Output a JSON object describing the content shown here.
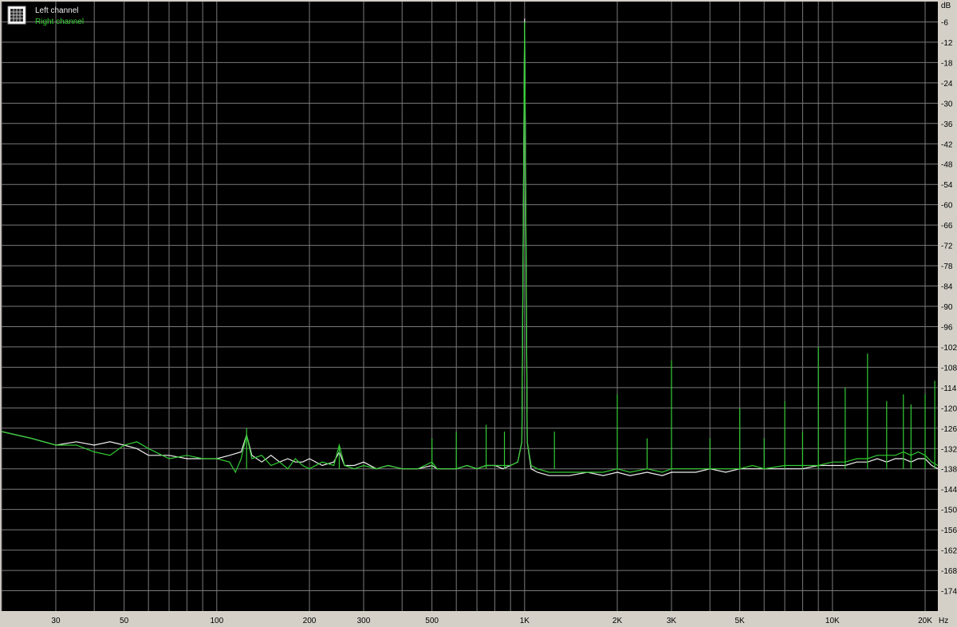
{
  "colors": {
    "plot_background": "#000000",
    "frame_background": "#d4d0c8",
    "grid": "#7a7a7a",
    "left_channel": "#f0f0f0",
    "right_channel": "#33cc33",
    "axis_text": "#000000"
  },
  "legend": {
    "icon": "grid-chart-icon",
    "items": [
      {
        "label": "Left channel",
        "color": "#f0f0f0"
      },
      {
        "label": "Right channel",
        "color": "#33cc33"
      }
    ]
  },
  "chart_data": {
    "type": "line",
    "x_scale": "log",
    "xlim": [
      20,
      22000
    ],
    "ylim": [
      -180,
      0
    ],
    "x_unit": "Hz",
    "y_unit": "dB",
    "grid": true,
    "legend_position": "top-left",
    "x_ticks": [
      {
        "value": 30,
        "label": "30"
      },
      {
        "value": 50,
        "label": "50"
      },
      {
        "value": 100,
        "label": "100"
      },
      {
        "value": 200,
        "label": "200"
      },
      {
        "value": 300,
        "label": "300"
      },
      {
        "value": 500,
        "label": "500"
      },
      {
        "value": 1000,
        "label": "1K"
      },
      {
        "value": 2000,
        "label": "2K"
      },
      {
        "value": 3000,
        "label": "3K"
      },
      {
        "value": 5000,
        "label": "5K"
      },
      {
        "value": 10000,
        "label": "10K"
      },
      {
        "value": 20000,
        "label": "20K"
      }
    ],
    "y_ticks": [
      -6,
      -12,
      -18,
      -24,
      -30,
      -36,
      -42,
      -48,
      -54,
      -60,
      -66,
      -72,
      -78,
      -84,
      -90,
      -96,
      -102,
      -108,
      -114,
      -120,
      -126,
      -132,
      -138,
      -144,
      -150,
      -156,
      -162,
      -168,
      -174
    ],
    "series": [
      {
        "name": "Left channel",
        "color": "#f0f0f0",
        "x": [
          20,
          25,
          30,
          35,
          40,
          45,
          50,
          55,
          60,
          70,
          80,
          90,
          100,
          110,
          120,
          125,
          130,
          140,
          150,
          160,
          170,
          180,
          190,
          200,
          220,
          240,
          250,
          260,
          280,
          300,
          330,
          360,
          400,
          450,
          500,
          520,
          550,
          600,
          650,
          700,
          750,
          800,
          850,
          900,
          950,
          980,
          1000,
          1020,
          1050,
          1100,
          1200,
          1400,
          1600,
          1800,
          2000,
          2200,
          2500,
          2800,
          3000,
          3300,
          3600,
          4000,
          4500,
          5000,
          5500,
          6000,
          7000,
          8000,
          9000,
          10000,
          11000,
          12000,
          13000,
          14000,
          15000,
          16000,
          17000,
          18000,
          19000,
          20000,
          21000,
          22000
        ],
        "y": [
          -127,
          -129,
          -131,
          -130,
          -131,
          -130,
          -131,
          -132,
          -134,
          -134,
          -135,
          -135,
          -135,
          -134,
          -133,
          -128,
          -134,
          -136,
          -134,
          -136,
          -135,
          -136,
          -136,
          -135,
          -137,
          -136,
          -133,
          -137,
          -137,
          -136,
          -138,
          -137,
          -138,
          -138,
          -137,
          -138,
          -138,
          -138,
          -137,
          -138,
          -137,
          -137,
          -138,
          -137,
          -136,
          -130,
          -5,
          -130,
          -138,
          -139,
          -140,
          -140,
          -139,
          -140,
          -139,
          -140,
          -139,
          -140,
          -139,
          -139,
          -139,
          -138,
          -139,
          -138,
          -138,
          -138,
          -138,
          -138,
          -137,
          -137,
          -137,
          -136,
          -136,
          -135,
          -136,
          -135,
          -135,
          -136,
          -135,
          -135,
          -137,
          -138
        ]
      },
      {
        "name": "Right channel",
        "color": "#33cc33",
        "x": [
          20,
          25,
          30,
          35,
          40,
          45,
          50,
          55,
          60,
          70,
          80,
          90,
          100,
          110,
          115,
          120,
          125,
          130,
          140,
          150,
          160,
          170,
          180,
          190,
          200,
          220,
          240,
          250,
          260,
          280,
          300,
          330,
          360,
          400,
          450,
          500,
          520,
          550,
          600,
          650,
          700,
          750,
          800,
          850,
          900,
          950,
          980,
          1000,
          1020,
          1050,
          1100,
          1200,
          1400,
          1600,
          1800,
          2000,
          2200,
          2500,
          2800,
          3000,
          3300,
          3600,
          4000,
          4500,
          5000,
          5500,
          6000,
          7000,
          8000,
          9000,
          10000,
          11000,
          12000,
          13000,
          14000,
          15000,
          16000,
          17000,
          18000,
          19000,
          20000,
          21000,
          22000
        ],
        "y": [
          -127,
          -129,
          -131,
          -131,
          -133,
          -134,
          -131,
          -130,
          -132,
          -135,
          -134,
          -135,
          -135,
          -136,
          -139,
          -135,
          -128,
          -135,
          -134,
          -137,
          -136,
          -138,
          -135,
          -137,
          -138,
          -136,
          -137,
          -131,
          -137,
          -138,
          -137,
          -138,
          -137,
          -138,
          -138,
          -136,
          -138,
          -138,
          -138,
          -137,
          -138,
          -137,
          -137,
          -137,
          -137,
          -136,
          -130,
          -6,
          -130,
          -137,
          -138,
          -139,
          -139,
          -139,
          -139,
          -138,
          -139,
          -138,
          -139,
          -138,
          -138,
          -138,
          -138,
          -138,
          -138,
          -137,
          -138,
          -137,
          -137,
          -137,
          -136,
          -136,
          -135,
          -135,
          -134,
          -134,
          -134,
          -133,
          -134,
          -133,
          -134,
          -136,
          -137
        ]
      }
    ],
    "spikes": [
      {
        "series": "Right channel",
        "x": 125,
        "y": -126
      },
      {
        "series": "Right channel",
        "x": 250,
        "y": -131
      },
      {
        "series": "Right channel",
        "x": 500,
        "y": -129
      },
      {
        "series": "Right channel",
        "x": 600,
        "y": -127
      },
      {
        "series": "Right channel",
        "x": 750,
        "y": -125
      },
      {
        "series": "Right channel",
        "x": 860,
        "y": -127
      },
      {
        "series": "Right channel",
        "x": 1250,
        "y": -127
      },
      {
        "series": "Right channel",
        "x": 2000,
        "y": -116
      },
      {
        "series": "Right channel",
        "x": 2500,
        "y": -129
      },
      {
        "series": "Right channel",
        "x": 3000,
        "y": -106
      },
      {
        "series": "Right channel",
        "x": 4000,
        "y": -129
      },
      {
        "series": "Right channel",
        "x": 5000,
        "y": -120
      },
      {
        "series": "Right channel",
        "x": 6000,
        "y": -129
      },
      {
        "series": "Right channel",
        "x": 7000,
        "y": -118
      },
      {
        "series": "Right channel",
        "x": 8000,
        "y": -127
      },
      {
        "series": "Right channel",
        "x": 9000,
        "y": -102
      },
      {
        "series": "Right channel",
        "x": 11000,
        "y": -114
      },
      {
        "series": "Right channel",
        "x": 13000,
        "y": -104
      },
      {
        "series": "Right channel",
        "x": 15000,
        "y": -118
      },
      {
        "series": "Right channel",
        "x": 17000,
        "y": -116
      },
      {
        "series": "Right channel",
        "x": 18000,
        "y": -119
      },
      {
        "series": "Right channel",
        "x": 20000,
        "y": -116
      },
      {
        "series": "Right channel",
        "x": 21500,
        "y": -112
      }
    ]
  }
}
